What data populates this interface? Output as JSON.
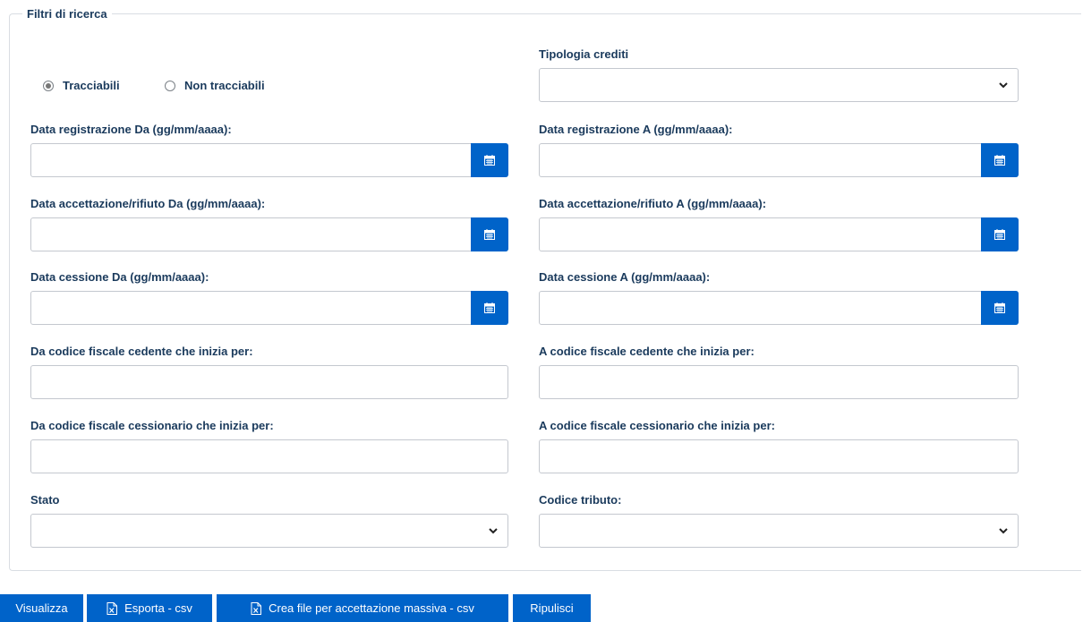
{
  "filters": {
    "legend": "Filtri di ricerca",
    "radio_traceable": "Tracciabili",
    "radio_non_traceable": "Non tracciabili",
    "tipologia_crediti_label": "Tipologia crediti",
    "data_registrazione_da_label": "Data registrazione Da (gg/mm/aaaa):",
    "data_registrazione_a_label": "Data registrazione A (gg/mm/aaaa):",
    "data_accettazione_da_label": "Data accettazione/rifiuto Da (gg/mm/aaaa):",
    "data_accettazione_a_label": "Data accettazione/rifiuto A (gg/mm/aaaa):",
    "data_cessione_da_label": "Data cessione Da (gg/mm/aaaa):",
    "data_cessione_a_label": "Data cessione A (gg/mm/aaaa):",
    "cf_cedente_da_label": "Da codice fiscale cedente che inizia per:",
    "cf_cedente_a_label": "A codice fiscale cedente che inizia per:",
    "cf_cessionario_da_label": "Da codice fiscale cessionario che inizia per:",
    "cf_cessionario_a_label": "A codice fiscale cessionario che inizia per:",
    "stato_label": "Stato",
    "codice_tributo_label": "Codice tributo:"
  },
  "values": {
    "tipologia_crediti": "",
    "data_registrazione_da": "",
    "data_registrazione_a": "",
    "data_accettazione_da": "",
    "data_accettazione_a": "",
    "data_cessione_da": "",
    "data_cessione_a": "",
    "cf_cedente_da": "",
    "cf_cedente_a": "",
    "cf_cessionario_da": "",
    "cf_cessionario_a": "",
    "stato": "",
    "codice_tributo": ""
  },
  "selected_radio": "Tracciabili",
  "buttons": {
    "visualizza": "Visualizza",
    "esporta": "Esporta - csv",
    "crea_file": "Crea file per accettazione massiva - csv",
    "ripulisci": "Ripulisci"
  },
  "icons": {
    "calendar": "calendar-icon",
    "chevron": "chevron-down-icon",
    "excel": "excel-file-icon"
  },
  "colors": {
    "accent": "#0063c9",
    "label": "#1a3a5c",
    "border": "#c4c8cf"
  }
}
